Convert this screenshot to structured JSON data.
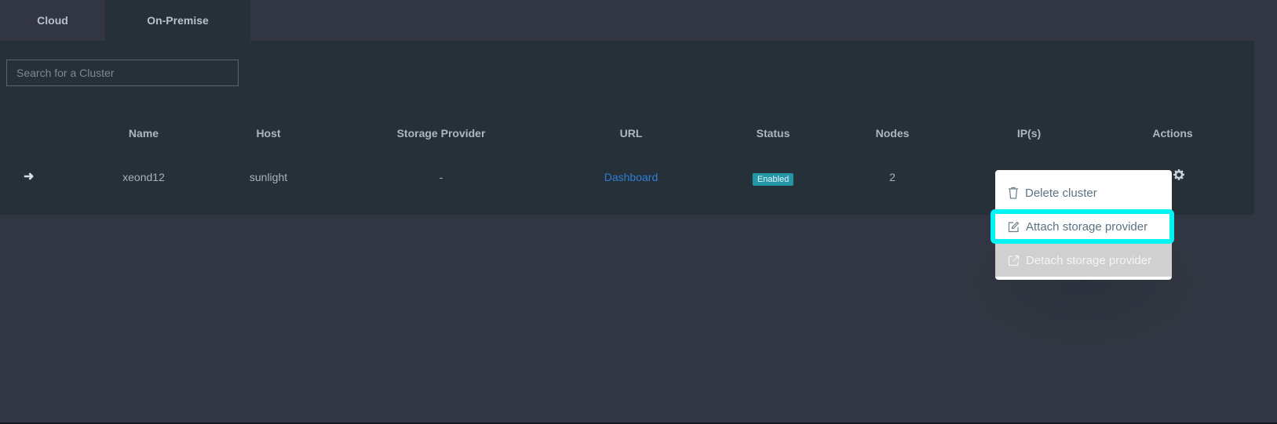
{
  "tabs": [
    {
      "label": "Cloud",
      "active": false
    },
    {
      "label": "On-Premise",
      "active": true
    }
  ],
  "search": {
    "placeholder": "Search for a Cluster",
    "value": ""
  },
  "table": {
    "columns": [
      "Name",
      "Host",
      "Storage Provider",
      "URL",
      "Status",
      "Nodes",
      "IP(s)",
      "Actions"
    ],
    "rows": [
      {
        "expand_icon": "arrow-right-icon",
        "name": "xeond12",
        "host": "sunlight",
        "storage_provider": "-",
        "url": "Dashboard",
        "status": "Enabled",
        "nodes": "2",
        "ips": "",
        "actions_icon": "gear-icon"
      }
    ]
  },
  "colors": {
    "link": "#2e7fd6",
    "status_badge": "#2396a8",
    "focus_ring": "#00f4f4"
  },
  "actions_menu": {
    "items": [
      {
        "label": "Delete cluster",
        "icon": "trash-icon",
        "state": "normal"
      },
      {
        "label": "Attach storage provider",
        "icon": "edit-icon",
        "state": "focused"
      },
      {
        "label": "Detach storage provider",
        "icon": "external-link-icon",
        "state": "disabled"
      }
    ]
  }
}
